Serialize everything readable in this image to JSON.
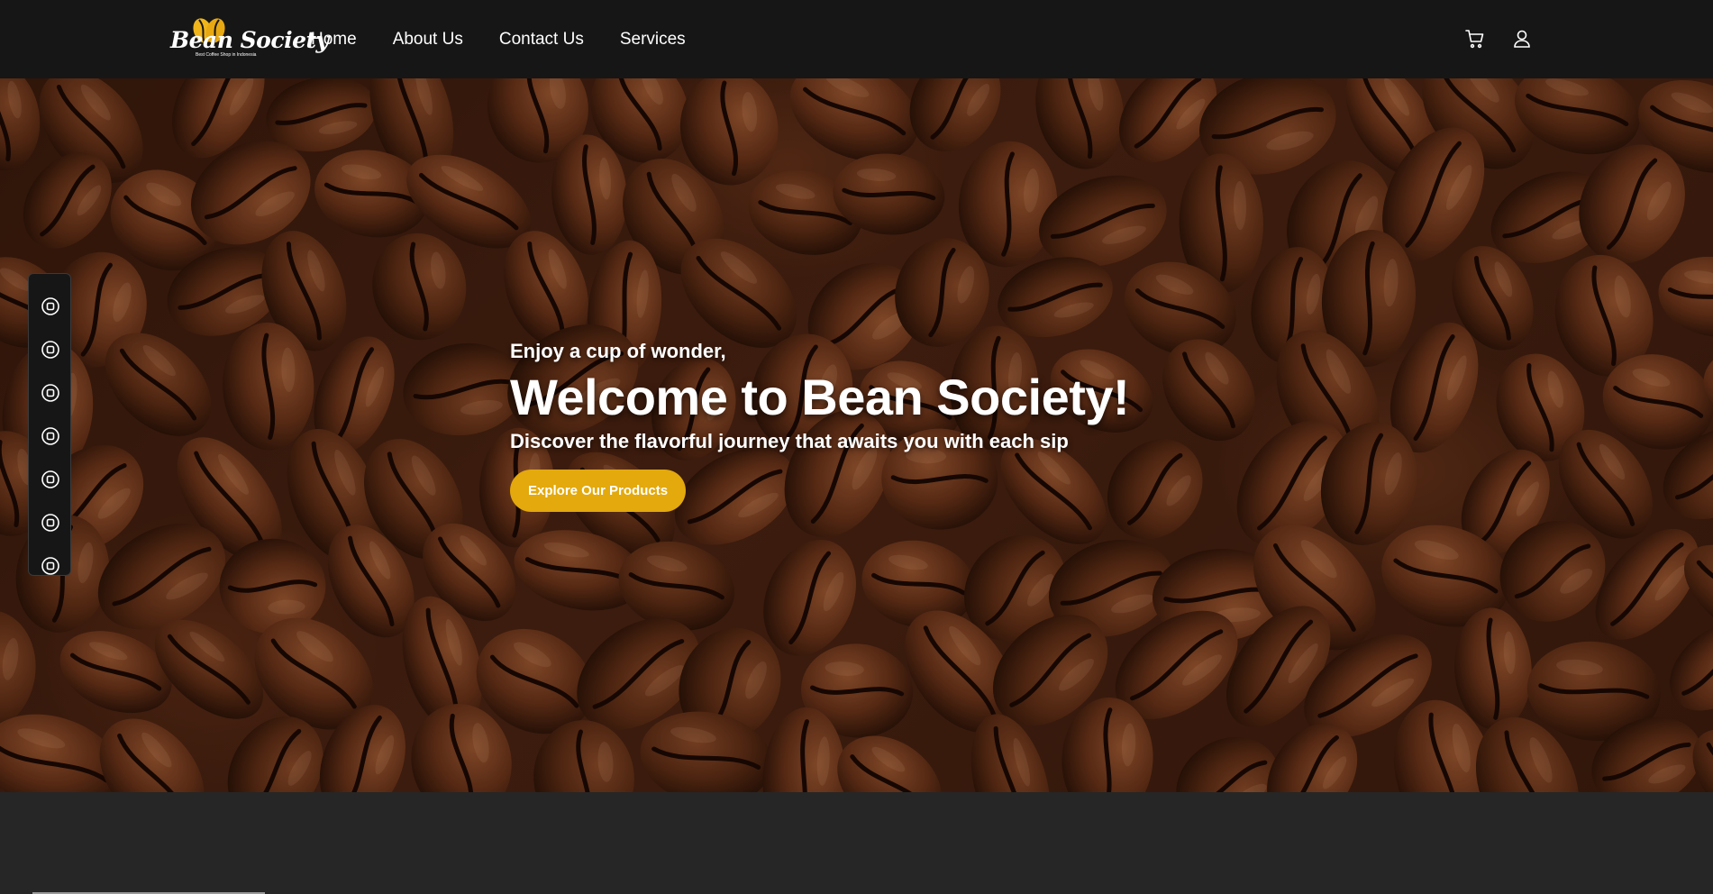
{
  "brand": {
    "name": "Bean Society",
    "tagline": "Best Coffee Shop in Indonesia",
    "logo_icon": "coffee-bean-leaf-logo",
    "accent_color": "#e3a90d"
  },
  "nav": {
    "links": [
      {
        "label": "Home"
      },
      {
        "label": "About Us"
      },
      {
        "label": "Contact Us"
      },
      {
        "label": "Services"
      }
    ],
    "icons": [
      "cart-icon",
      "user-icon"
    ]
  },
  "hero": {
    "eyebrow": "Enjoy a cup of wonder,",
    "title": "Welcome to Bean Society!",
    "subtitle": "Discover the flavorful journey that awaits you with each sip",
    "cta_label": "Explore Our Products",
    "cta_color": "#e3a90d"
  },
  "side_dock": {
    "icon": "target-circle-icon",
    "count": 7
  },
  "colors": {
    "navbar": "#161616",
    "page_bg": "#262626"
  }
}
